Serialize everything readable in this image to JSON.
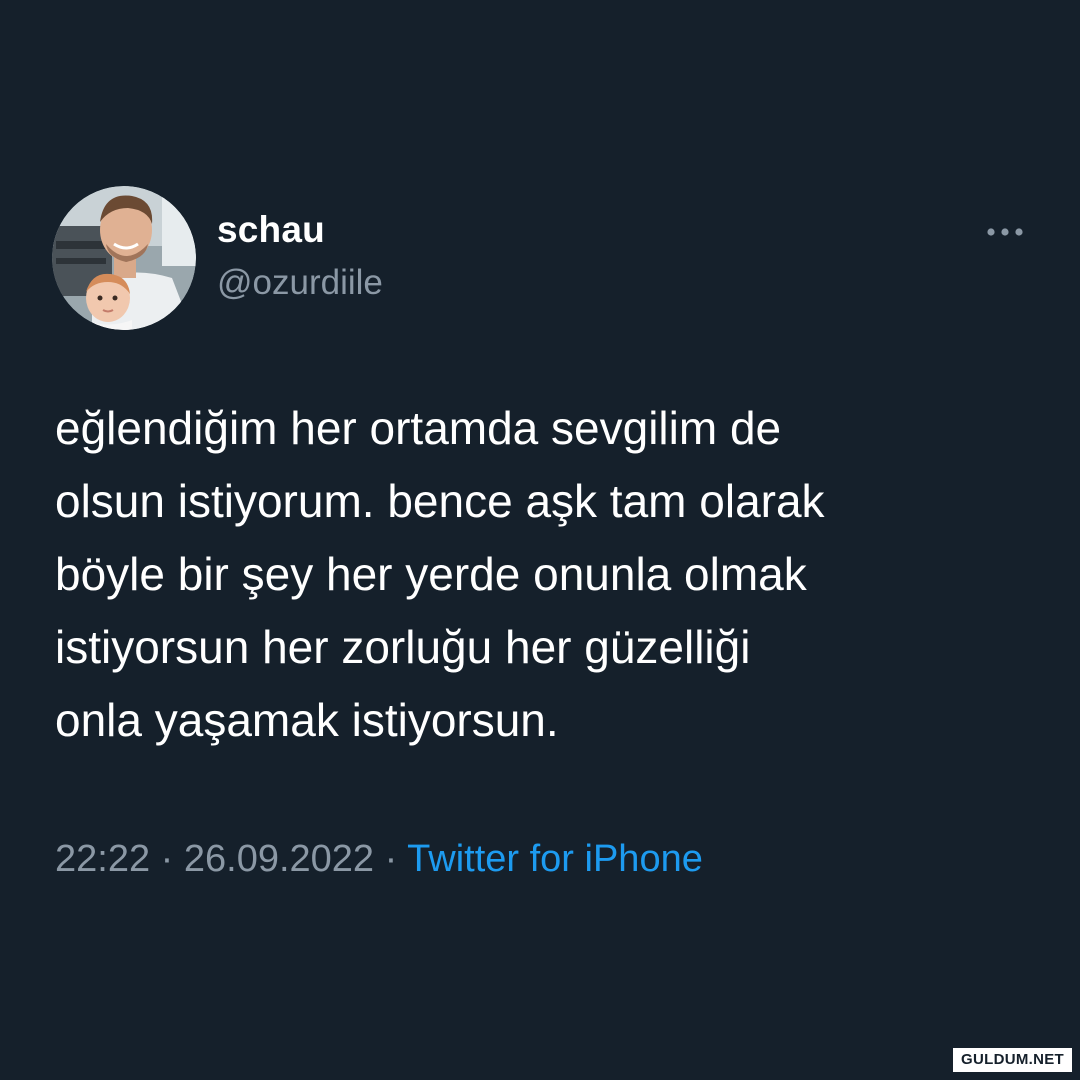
{
  "author": {
    "display_name": "schau",
    "handle": "@ozurdiile"
  },
  "tweet": {
    "lines": [
      "eğlendiğim her ortamda sevgilim de",
      "olsun istiyorum. bence aşk tam olarak",
      "böyle bir şey her yerde onunla olmak",
      "istiyorsun her zorluğu her güzelliği",
      "onla yaşamak istiyorsun."
    ]
  },
  "meta": {
    "time": "22:22",
    "separator": " · ",
    "date": "26.09.2022",
    "source": "Twitter for iPhone"
  },
  "icons": {
    "more": "more-horizontal-icon",
    "avatar": "profile-avatar"
  },
  "colors": {
    "background": "#15202b",
    "text_primary": "#ffffff",
    "text_secondary": "#8b98a5",
    "accent": "#1d9bf0"
  },
  "watermark": "GULDUM.NET"
}
